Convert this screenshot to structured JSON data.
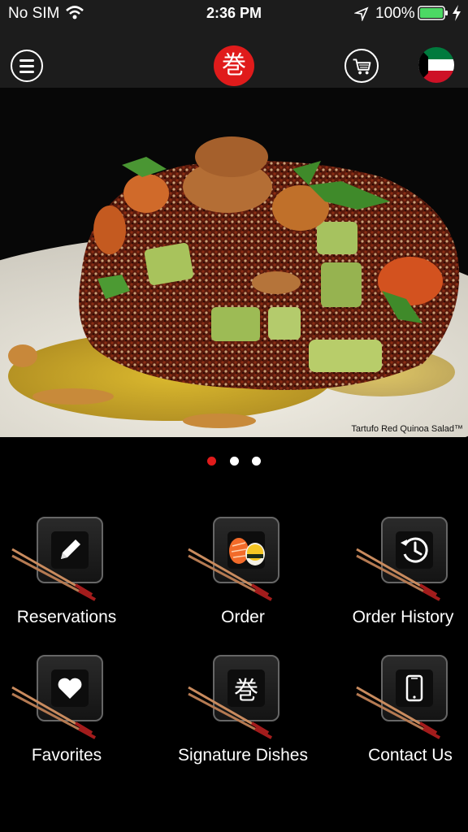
{
  "status_bar": {
    "carrier": "No SIM",
    "time": "2:36 PM",
    "battery_percent": "100%",
    "wifi_icon": "wifi-icon",
    "location_icon": "location-arrow-icon",
    "battery_icon": "battery-icon",
    "charging_icon": "bolt-icon"
  },
  "nav": {
    "menu_icon": "hamburger-menu-icon",
    "logo_glyph": "巻",
    "cart_icon": "cart-icon",
    "flag_icon": "kuwait-flag-icon"
  },
  "hero": {
    "caption": "Tartufo Red Quinoa Salad™",
    "slides_total": 3,
    "active_slide": 1
  },
  "tiles": [
    {
      "label": "Reservations",
      "icon": "pencil-icon"
    },
    {
      "label": "Order",
      "icon": "sushi-icon"
    },
    {
      "label": "Order History",
      "icon": "clock-history-icon"
    },
    {
      "label": "Favorites",
      "icon": "heart-icon"
    },
    {
      "label": "Signature Dishes",
      "icon": "kanji-icon",
      "glyph": "巻"
    },
    {
      "label": "Contact Us",
      "icon": "phone-icon"
    }
  ],
  "colors": {
    "accent": "#e01b1b",
    "background": "#000000",
    "bar": "#1c1c1c",
    "battery": "#4cd964"
  }
}
